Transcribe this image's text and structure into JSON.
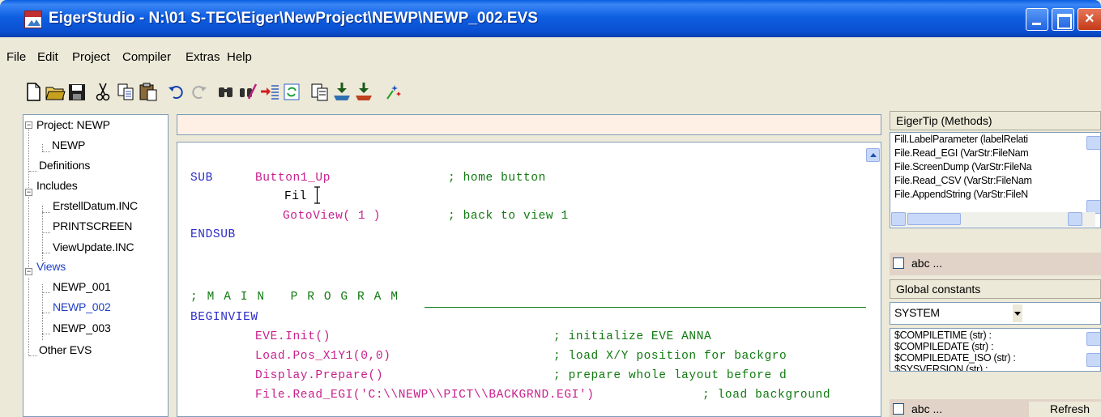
{
  "window": {
    "title": "EigerStudio - N:\\01  S-TEC\\Eiger\\NewProject\\NEWP\\NEWP_002.EVS",
    "icon": "app-logo-icon",
    "titlebar_color": "#0a5ee0"
  },
  "menu": [
    "File",
    "Edit",
    "Project",
    "Compiler",
    "Extras",
    "Help"
  ],
  "toolbar": [
    {
      "name": "new-file-icon"
    },
    {
      "name": "open-folder-icon"
    },
    {
      "name": "save-icon"
    },
    {
      "name": "cut-icon"
    },
    {
      "name": "copy-icon"
    },
    {
      "name": "paste-icon"
    },
    {
      "name": "undo-icon"
    },
    {
      "name": "redo-icon"
    },
    {
      "name": "find-icon"
    },
    {
      "name": "find-replace-icon"
    },
    {
      "name": "indent-icon"
    },
    {
      "name": "refresh-icon"
    },
    {
      "name": "properties-icon"
    },
    {
      "name": "compile-icon"
    },
    {
      "name": "compile-run-icon"
    },
    {
      "name": "wizard-icon"
    }
  ],
  "tree": {
    "project": "Project: NEWP",
    "project_child": "NEWP",
    "definitions": "Definitions",
    "includes": "Includes",
    "include_items": [
      "ErstellDatum.INC",
      "PRINTSCREEN",
      "ViewUpdate.INC"
    ],
    "views": "Views",
    "view_items": [
      "NEWP_001",
      "NEWP_002",
      "NEWP_003"
    ],
    "other": "Other EVS"
  },
  "editor": {
    "sub_kw": "SUB",
    "sub_name": "Button1_Up",
    "sub_comment": "; home button",
    "line_fil": "Fil",
    "goto_call": "GotoView( 1 )",
    "goto_comment": "; back to view 1",
    "endsub": "ENDSUB",
    "main_header": "; M A I N   P R O G R A M",
    "beginview": "BEGINVIEW",
    "calls": [
      {
        "code": "EVE.Init()",
        "comment": "; initialize EVE ANNA"
      },
      {
        "code": "Load.Pos_X1Y1(0,0)",
        "comment": "; load X/Y position for backgro"
      },
      {
        "code": "Display.Prepare()",
        "comment": "; prepare whole layout before d"
      },
      {
        "code": "File.Read_EGI('C:\\\\NEWP\\\\PICT\\\\BACKGRND.EGI')",
        "comment": "; load background"
      }
    ],
    "colors": {
      "keyword": "#2b2bc8",
      "function": "#c8208e",
      "comment": "#107a10"
    }
  },
  "eigertip": {
    "header": "EigerTip (Methods)",
    "items": [
      "Fill.LabelParameter (labelRelati",
      "File.Read_EGI (VarStr:FileNam",
      "File.ScreenDump (VarStr:FileNa",
      "File.Read_CSV (VarStr:FileNam",
      "File.AppendString (VarStr:FileN"
    ],
    "checkbox_label": "abc ..."
  },
  "constants": {
    "header": "Global constants",
    "dropdown_value": "SYSTEM",
    "items": [
      "$COMPILETIME (str) :",
      "$COMPILEDATE (str) :",
      "$COMPILEDATE_ISO (str) :",
      "$SYSVERSION (str) :"
    ],
    "checkbox_label": "abc ...",
    "refresh_label": "Refresh"
  }
}
